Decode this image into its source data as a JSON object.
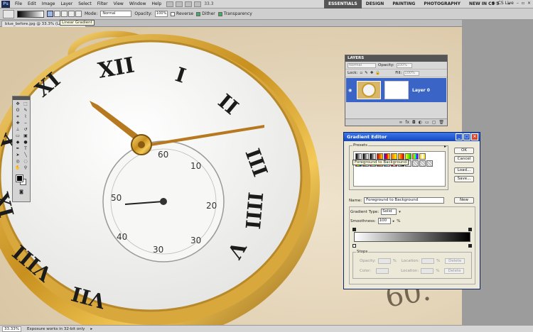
{
  "menubar": {
    "logo": "Ps",
    "items": [
      "File",
      "Edit",
      "Image",
      "Layer",
      "Select",
      "Filter",
      "View",
      "Window",
      "Help"
    ],
    "zoom": "33.3",
    "workspaces": [
      "ESSENTIALS",
      "DESIGN",
      "PAINTING",
      "PHOTOGRAPHY",
      "NEW IN CS 5"
    ],
    "more": "»",
    "cslive": "CS Live"
  },
  "options": {
    "mode_label": "Mode:",
    "mode_value": "Normal",
    "opacity_label": "Opacity:",
    "opacity_value": "100%",
    "reverse": "Reverse",
    "dither": "Dither",
    "transparency": "Transparency",
    "tooltip": "Linear Gradient"
  },
  "document": {
    "tab": "blue_before.jpg @ 33.3% (Lay... ...k/8) *"
  },
  "status": {
    "zoom": "33.33%",
    "message": "Exposure works in 32-bit only"
  },
  "layers": {
    "title": "LAYERS",
    "blend_value": "Normal",
    "opacity_label": "Opacity:",
    "opacity_value": "100%",
    "lock_label": "Lock:",
    "fill_label": "Fill:",
    "fill_value": "100%",
    "layer_name": "Layer 0"
  },
  "gradient_editor": {
    "title": "Gradient Editor",
    "presets_label": "Presets",
    "preset_tooltip": "Foreground to Background",
    "ok": "OK",
    "cancel": "Cancel",
    "load": "Load...",
    "save": "Save...",
    "name_label": "Name:",
    "name_value": "Foreground to Background",
    "new": "New",
    "type_label": "Gradient Type:",
    "type_value": "Solid",
    "smoothness_label": "Smoothness:",
    "smoothness_value": "100",
    "smoothness_unit": "%",
    "stops_label": "Stops",
    "opacity_label": "Opacity:",
    "color_label": "Color:",
    "location_label": "Location:",
    "percent": "%",
    "delete": "Delete"
  }
}
